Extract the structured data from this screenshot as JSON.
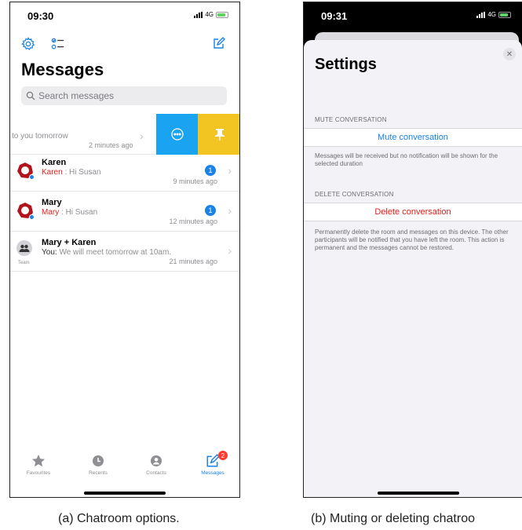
{
  "left_phone": {
    "status": {
      "time": "09:30",
      "network": "4G"
    },
    "title": "Messages",
    "search": {
      "placeholder": "Search messages"
    },
    "swiped_row": {
      "preview": "to you tomorrow",
      "time": "2 minutes ago"
    },
    "conversations": [
      {
        "name": "Karen",
        "sender": "Karen",
        "separator": " : ",
        "message": "Hi Susan",
        "time": "9 minutes ago",
        "badge": "1"
      },
      {
        "name": "Mary",
        "sender": "Mary",
        "separator": " : ",
        "message": "Hi Susan",
        "time": "12 minutes ago",
        "badge": "1"
      },
      {
        "name": "Mary + Karen",
        "sender": "You:",
        "separator": " ",
        "message": "We will meet tomorrow at 10am.",
        "time": "21 minutes ago",
        "team_label": "Team"
      }
    ],
    "tabs": [
      {
        "label": "Favourites",
        "icon": "star-icon"
      },
      {
        "label": "Recents",
        "icon": "clock-icon"
      },
      {
        "label": "Contacts",
        "icon": "person-icon"
      },
      {
        "label": "Messages",
        "icon": "compose-icon",
        "badge": "2"
      }
    ],
    "caption": "(a) Chatroom options."
  },
  "right_phone": {
    "status": {
      "time": "09:31",
      "network": "4G"
    },
    "title": "Settings",
    "mute": {
      "header": "MUTE CONVERSATION",
      "button": "Mute conversation",
      "footer": "Messages will be received but no notification will be shown for the selected duration"
    },
    "delete": {
      "header": "DELETE CONVERSATION",
      "button": "Delete conversation",
      "footer": "Permanently delete the room and messages on this device. The other participants will be notified that you have left the room. This action is permanent and the messages cannot be restored."
    },
    "caption": "(b) Muting or deleting chatroo"
  },
  "colors": {
    "accent": "#1a82e8",
    "alert": "#e0201b",
    "swipe_more": "#1aa3f0",
    "swipe_pin": "#f2c523"
  }
}
